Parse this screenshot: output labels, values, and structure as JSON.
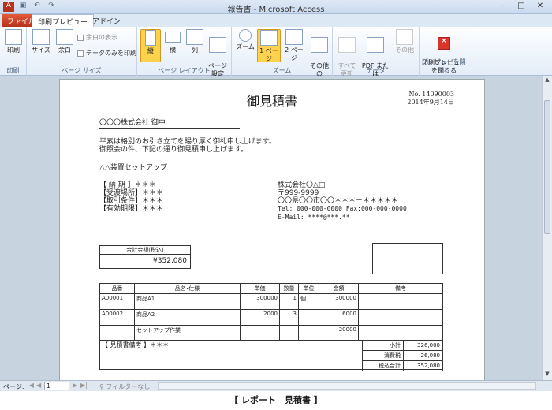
{
  "titlebar": {
    "title": "報告書 - Microsoft Access"
  },
  "tabs": {
    "file": "ファイル",
    "print_preview": "印刷プレビュー",
    "addin": "アドイン"
  },
  "ribbon": {
    "print": {
      "btn": "印刷",
      "group": "印刷"
    },
    "pagesize": {
      "size": "サイズ",
      "margin": "余白",
      "show_margin": "余白の表示",
      "data_only": "データのみを印刷",
      "group": "ページ サイズ"
    },
    "layout": {
      "portrait": "縦",
      "landscape": "横",
      "columns": "列",
      "page_setup": "ページ\n設定",
      "group": "ページ レイアウト"
    },
    "zoom": {
      "zoom": "ズーム",
      "one_page": "1 ページ",
      "two_page": "2 ページ",
      "other_pages": "その他の\nページ",
      "group": "ズーム"
    },
    "data": {
      "refresh_all": "すべて\n更新",
      "pdf_xps": "PDF または\nXPS",
      "other": "その他",
      "group": "データ"
    },
    "close": {
      "btn": "印刷プレビュー\nを閉じる",
      "group": "プレビューを閉じる"
    }
  },
  "doc": {
    "title": "御見積書",
    "number": "No. 14090003",
    "date": "2014年9月14日",
    "recipient": "〇〇〇株式会社 御中",
    "greeting1": "平素は格別のお引き立てを賜り厚く御礼申し上げます。",
    "greeting2": "御照会の件、下記の通り御見積申し上げます。",
    "subject": "△△装置セットアップ",
    "terms": [
      "【 納  期 】＊＊＊",
      "【受渡場所】＊＊＊",
      "【取引条件】＊＊＊",
      "【有効期限】＊＊＊"
    ],
    "company": [
      "株式会社〇△□",
      "〒999-9999",
      "〇〇県〇〇市〇〇＊＊＊－＊＊＊＊＊",
      "Tel: 000-000-0000  Fax:000-000-0000",
      "E-Mail: ****@***.**"
    ],
    "total_label": "合計金額(税込)",
    "total_value": "¥352,080",
    "headers": [
      "品番",
      "品名･仕様",
      "単価",
      "数量",
      "単位",
      "金額",
      "備考"
    ],
    "rows": [
      [
        "A00001",
        "商品A1",
        "300000",
        "1",
        "個",
        "300000",
        ""
      ],
      [
        "A00002",
        "商品A2",
        "2000",
        "3",
        "",
        "6000",
        ""
      ],
      [
        "",
        "セットアップ作業",
        "",
        "",
        "",
        "20000",
        ""
      ]
    ],
    "notes": "【 見積書備考 】＊＊＊",
    "subtotal_label": "小計",
    "subtotal": "326,000",
    "tax_label": "消費税",
    "tax": "26,080",
    "total2_label": "税込合計",
    "total2": "352,080"
  },
  "status": {
    "page_label": "ページ:",
    "page_value": "1",
    "filter": "フィルターなし"
  },
  "caption": "【 レポート　見積書 】"
}
